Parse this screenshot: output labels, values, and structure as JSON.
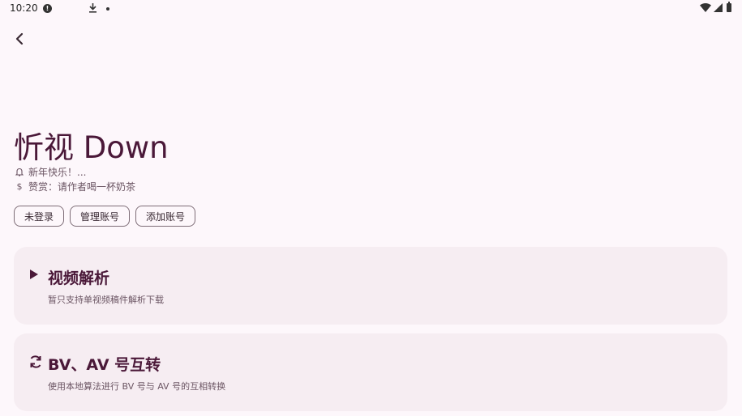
{
  "status_bar": {
    "time": "10:20"
  },
  "app": {
    "title": "忻视 Down",
    "notice": "新年快乐！...",
    "donate": "赞赏：请作者喝一杯奶茶",
    "icons": {
      "back": "arrow-back-icon",
      "notice": "bell-icon",
      "donate": "dollar-icon"
    }
  },
  "chips": [
    {
      "label": "未登录"
    },
    {
      "label": "管理账号"
    },
    {
      "label": "添加账号"
    }
  ],
  "cards": [
    {
      "icon": "play-icon",
      "title": "视频解析",
      "description": "暂只支持单视频稿件解析下载"
    },
    {
      "icon": "sync-icon",
      "title": "BV、AV 号互转",
      "description": "使用本地算法进行 BV 号与 AV 号的互相转换"
    }
  ],
  "colors": {
    "background": "#fdf7fb",
    "accent": "#4a1838",
    "card": "#f6edf2"
  }
}
